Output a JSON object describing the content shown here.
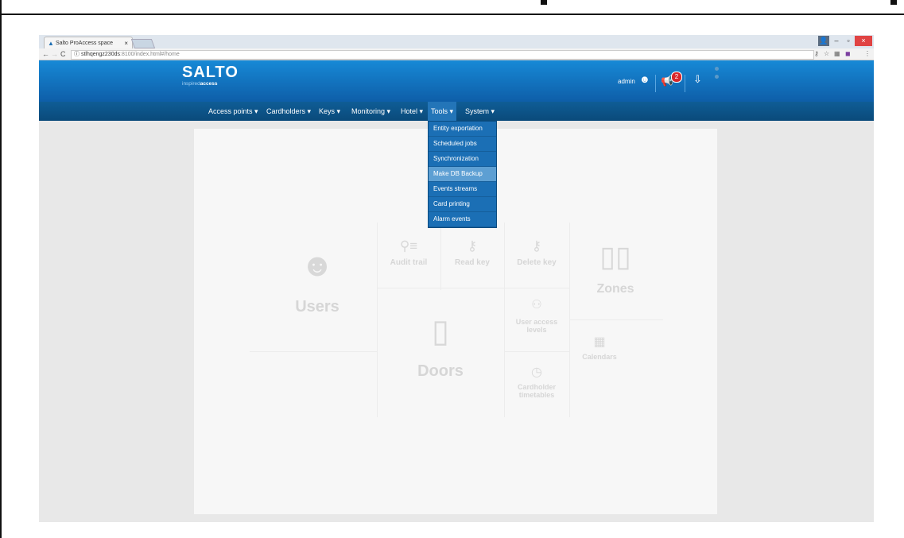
{
  "browser": {
    "tab_title": "Salto ProAccess space",
    "tab_close": "×",
    "url_host": "stlhqengz230ds",
    "url_path": ":8100/index.html#/home",
    "win_min": "–",
    "win_max": "▫",
    "win_close": "×"
  },
  "header": {
    "logo": "SALTO",
    "logo_sub_1": "inspired",
    "logo_sub_2": "access",
    "username": "admin",
    "notification_count": "2"
  },
  "menu": {
    "items": [
      {
        "label": "Access points ▾"
      },
      {
        "label": "Cardholders ▾"
      },
      {
        "label": "Keys ▾"
      },
      {
        "label": "Monitoring ▾"
      },
      {
        "label": "Hotel ▾"
      },
      {
        "label": "Tools ▾"
      },
      {
        "label": "System ▾"
      }
    ],
    "active": "Tools"
  },
  "tools_dropdown": [
    {
      "label": "Entity exportation"
    },
    {
      "label": "Scheduled jobs"
    },
    {
      "label": "Synchronization"
    },
    {
      "label": "Make DB Backup"
    },
    {
      "label": "Events streams"
    },
    {
      "label": "Card printing"
    },
    {
      "label": "Alarm events"
    }
  ],
  "dashboard": {
    "users": "Users",
    "audit_trail": "Audit trail",
    "read_key": "Read key",
    "delete_key": "Delete key",
    "zones": "Zones",
    "user_access_levels": "User access levels",
    "doors": "Doors",
    "calendars": "Calendars",
    "cardholder_timetables": "Cardholder timetables"
  },
  "colors": {
    "header_blue": "#1789d6",
    "menu_blue": "#0f5d96",
    "badge_red": "#d7262a"
  }
}
